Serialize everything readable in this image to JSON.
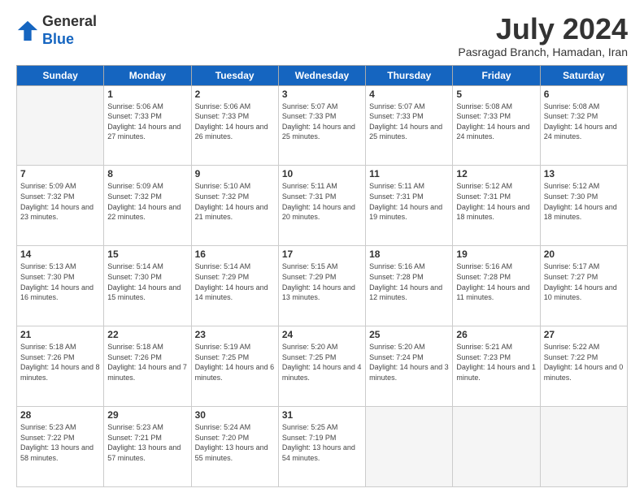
{
  "logo": {
    "general": "General",
    "blue": "Blue"
  },
  "header": {
    "month": "July 2024",
    "location": "Pasragad Branch, Hamadan, Iran"
  },
  "days_of_week": [
    "Sunday",
    "Monday",
    "Tuesday",
    "Wednesday",
    "Thursday",
    "Friday",
    "Saturday"
  ],
  "weeks": [
    [
      {
        "day": "",
        "sunrise": "",
        "sunset": "",
        "daylight": "",
        "empty": true
      },
      {
        "day": "1",
        "sunrise": "Sunrise: 5:06 AM",
        "sunset": "Sunset: 7:33 PM",
        "daylight": "Daylight: 14 hours and 27 minutes."
      },
      {
        "day": "2",
        "sunrise": "Sunrise: 5:06 AM",
        "sunset": "Sunset: 7:33 PM",
        "daylight": "Daylight: 14 hours and 26 minutes."
      },
      {
        "day": "3",
        "sunrise": "Sunrise: 5:07 AM",
        "sunset": "Sunset: 7:33 PM",
        "daylight": "Daylight: 14 hours and 25 minutes."
      },
      {
        "day": "4",
        "sunrise": "Sunrise: 5:07 AM",
        "sunset": "Sunset: 7:33 PM",
        "daylight": "Daylight: 14 hours and 25 minutes."
      },
      {
        "day": "5",
        "sunrise": "Sunrise: 5:08 AM",
        "sunset": "Sunset: 7:33 PM",
        "daylight": "Daylight: 14 hours and 24 minutes."
      },
      {
        "day": "6",
        "sunrise": "Sunrise: 5:08 AM",
        "sunset": "Sunset: 7:32 PM",
        "daylight": "Daylight: 14 hours and 24 minutes."
      }
    ],
    [
      {
        "day": "7",
        "sunrise": "Sunrise: 5:09 AM",
        "sunset": "Sunset: 7:32 PM",
        "daylight": "Daylight: 14 hours and 23 minutes."
      },
      {
        "day": "8",
        "sunrise": "Sunrise: 5:09 AM",
        "sunset": "Sunset: 7:32 PM",
        "daylight": "Daylight: 14 hours and 22 minutes."
      },
      {
        "day": "9",
        "sunrise": "Sunrise: 5:10 AM",
        "sunset": "Sunset: 7:32 PM",
        "daylight": "Daylight: 14 hours and 21 minutes."
      },
      {
        "day": "10",
        "sunrise": "Sunrise: 5:11 AM",
        "sunset": "Sunset: 7:31 PM",
        "daylight": "Daylight: 14 hours and 20 minutes."
      },
      {
        "day": "11",
        "sunrise": "Sunrise: 5:11 AM",
        "sunset": "Sunset: 7:31 PM",
        "daylight": "Daylight: 14 hours and 19 minutes."
      },
      {
        "day": "12",
        "sunrise": "Sunrise: 5:12 AM",
        "sunset": "Sunset: 7:31 PM",
        "daylight": "Daylight: 14 hours and 18 minutes."
      },
      {
        "day": "13",
        "sunrise": "Sunrise: 5:12 AM",
        "sunset": "Sunset: 7:30 PM",
        "daylight": "Daylight: 14 hours and 18 minutes."
      }
    ],
    [
      {
        "day": "14",
        "sunrise": "Sunrise: 5:13 AM",
        "sunset": "Sunset: 7:30 PM",
        "daylight": "Daylight: 14 hours and 16 minutes."
      },
      {
        "day": "15",
        "sunrise": "Sunrise: 5:14 AM",
        "sunset": "Sunset: 7:30 PM",
        "daylight": "Daylight: 14 hours and 15 minutes."
      },
      {
        "day": "16",
        "sunrise": "Sunrise: 5:14 AM",
        "sunset": "Sunset: 7:29 PM",
        "daylight": "Daylight: 14 hours and 14 minutes."
      },
      {
        "day": "17",
        "sunrise": "Sunrise: 5:15 AM",
        "sunset": "Sunset: 7:29 PM",
        "daylight": "Daylight: 14 hours and 13 minutes."
      },
      {
        "day": "18",
        "sunrise": "Sunrise: 5:16 AM",
        "sunset": "Sunset: 7:28 PM",
        "daylight": "Daylight: 14 hours and 12 minutes."
      },
      {
        "day": "19",
        "sunrise": "Sunrise: 5:16 AM",
        "sunset": "Sunset: 7:28 PM",
        "daylight": "Daylight: 14 hours and 11 minutes."
      },
      {
        "day": "20",
        "sunrise": "Sunrise: 5:17 AM",
        "sunset": "Sunset: 7:27 PM",
        "daylight": "Daylight: 14 hours and 10 minutes."
      }
    ],
    [
      {
        "day": "21",
        "sunrise": "Sunrise: 5:18 AM",
        "sunset": "Sunset: 7:26 PM",
        "daylight": "Daylight: 14 hours and 8 minutes."
      },
      {
        "day": "22",
        "sunrise": "Sunrise: 5:18 AM",
        "sunset": "Sunset: 7:26 PM",
        "daylight": "Daylight: 14 hours and 7 minutes."
      },
      {
        "day": "23",
        "sunrise": "Sunrise: 5:19 AM",
        "sunset": "Sunset: 7:25 PM",
        "daylight": "Daylight: 14 hours and 6 minutes."
      },
      {
        "day": "24",
        "sunrise": "Sunrise: 5:20 AM",
        "sunset": "Sunset: 7:25 PM",
        "daylight": "Daylight: 14 hours and 4 minutes."
      },
      {
        "day": "25",
        "sunrise": "Sunrise: 5:20 AM",
        "sunset": "Sunset: 7:24 PM",
        "daylight": "Daylight: 14 hours and 3 minutes."
      },
      {
        "day": "26",
        "sunrise": "Sunrise: 5:21 AM",
        "sunset": "Sunset: 7:23 PM",
        "daylight": "Daylight: 14 hours and 1 minute."
      },
      {
        "day": "27",
        "sunrise": "Sunrise: 5:22 AM",
        "sunset": "Sunset: 7:22 PM",
        "daylight": "Daylight: 14 hours and 0 minutes."
      }
    ],
    [
      {
        "day": "28",
        "sunrise": "Sunrise: 5:23 AM",
        "sunset": "Sunset: 7:22 PM",
        "daylight": "Daylight: 13 hours and 58 minutes."
      },
      {
        "day": "29",
        "sunrise": "Sunrise: 5:23 AM",
        "sunset": "Sunset: 7:21 PM",
        "daylight": "Daylight: 13 hours and 57 minutes."
      },
      {
        "day": "30",
        "sunrise": "Sunrise: 5:24 AM",
        "sunset": "Sunset: 7:20 PM",
        "daylight": "Daylight: 13 hours and 55 minutes."
      },
      {
        "day": "31",
        "sunrise": "Sunrise: 5:25 AM",
        "sunset": "Sunset: 7:19 PM",
        "daylight": "Daylight: 13 hours and 54 minutes."
      },
      {
        "day": "",
        "sunrise": "",
        "sunset": "",
        "daylight": "",
        "empty": true
      },
      {
        "day": "",
        "sunrise": "",
        "sunset": "",
        "daylight": "",
        "empty": true
      },
      {
        "day": "",
        "sunrise": "",
        "sunset": "",
        "daylight": "",
        "empty": true
      }
    ]
  ]
}
